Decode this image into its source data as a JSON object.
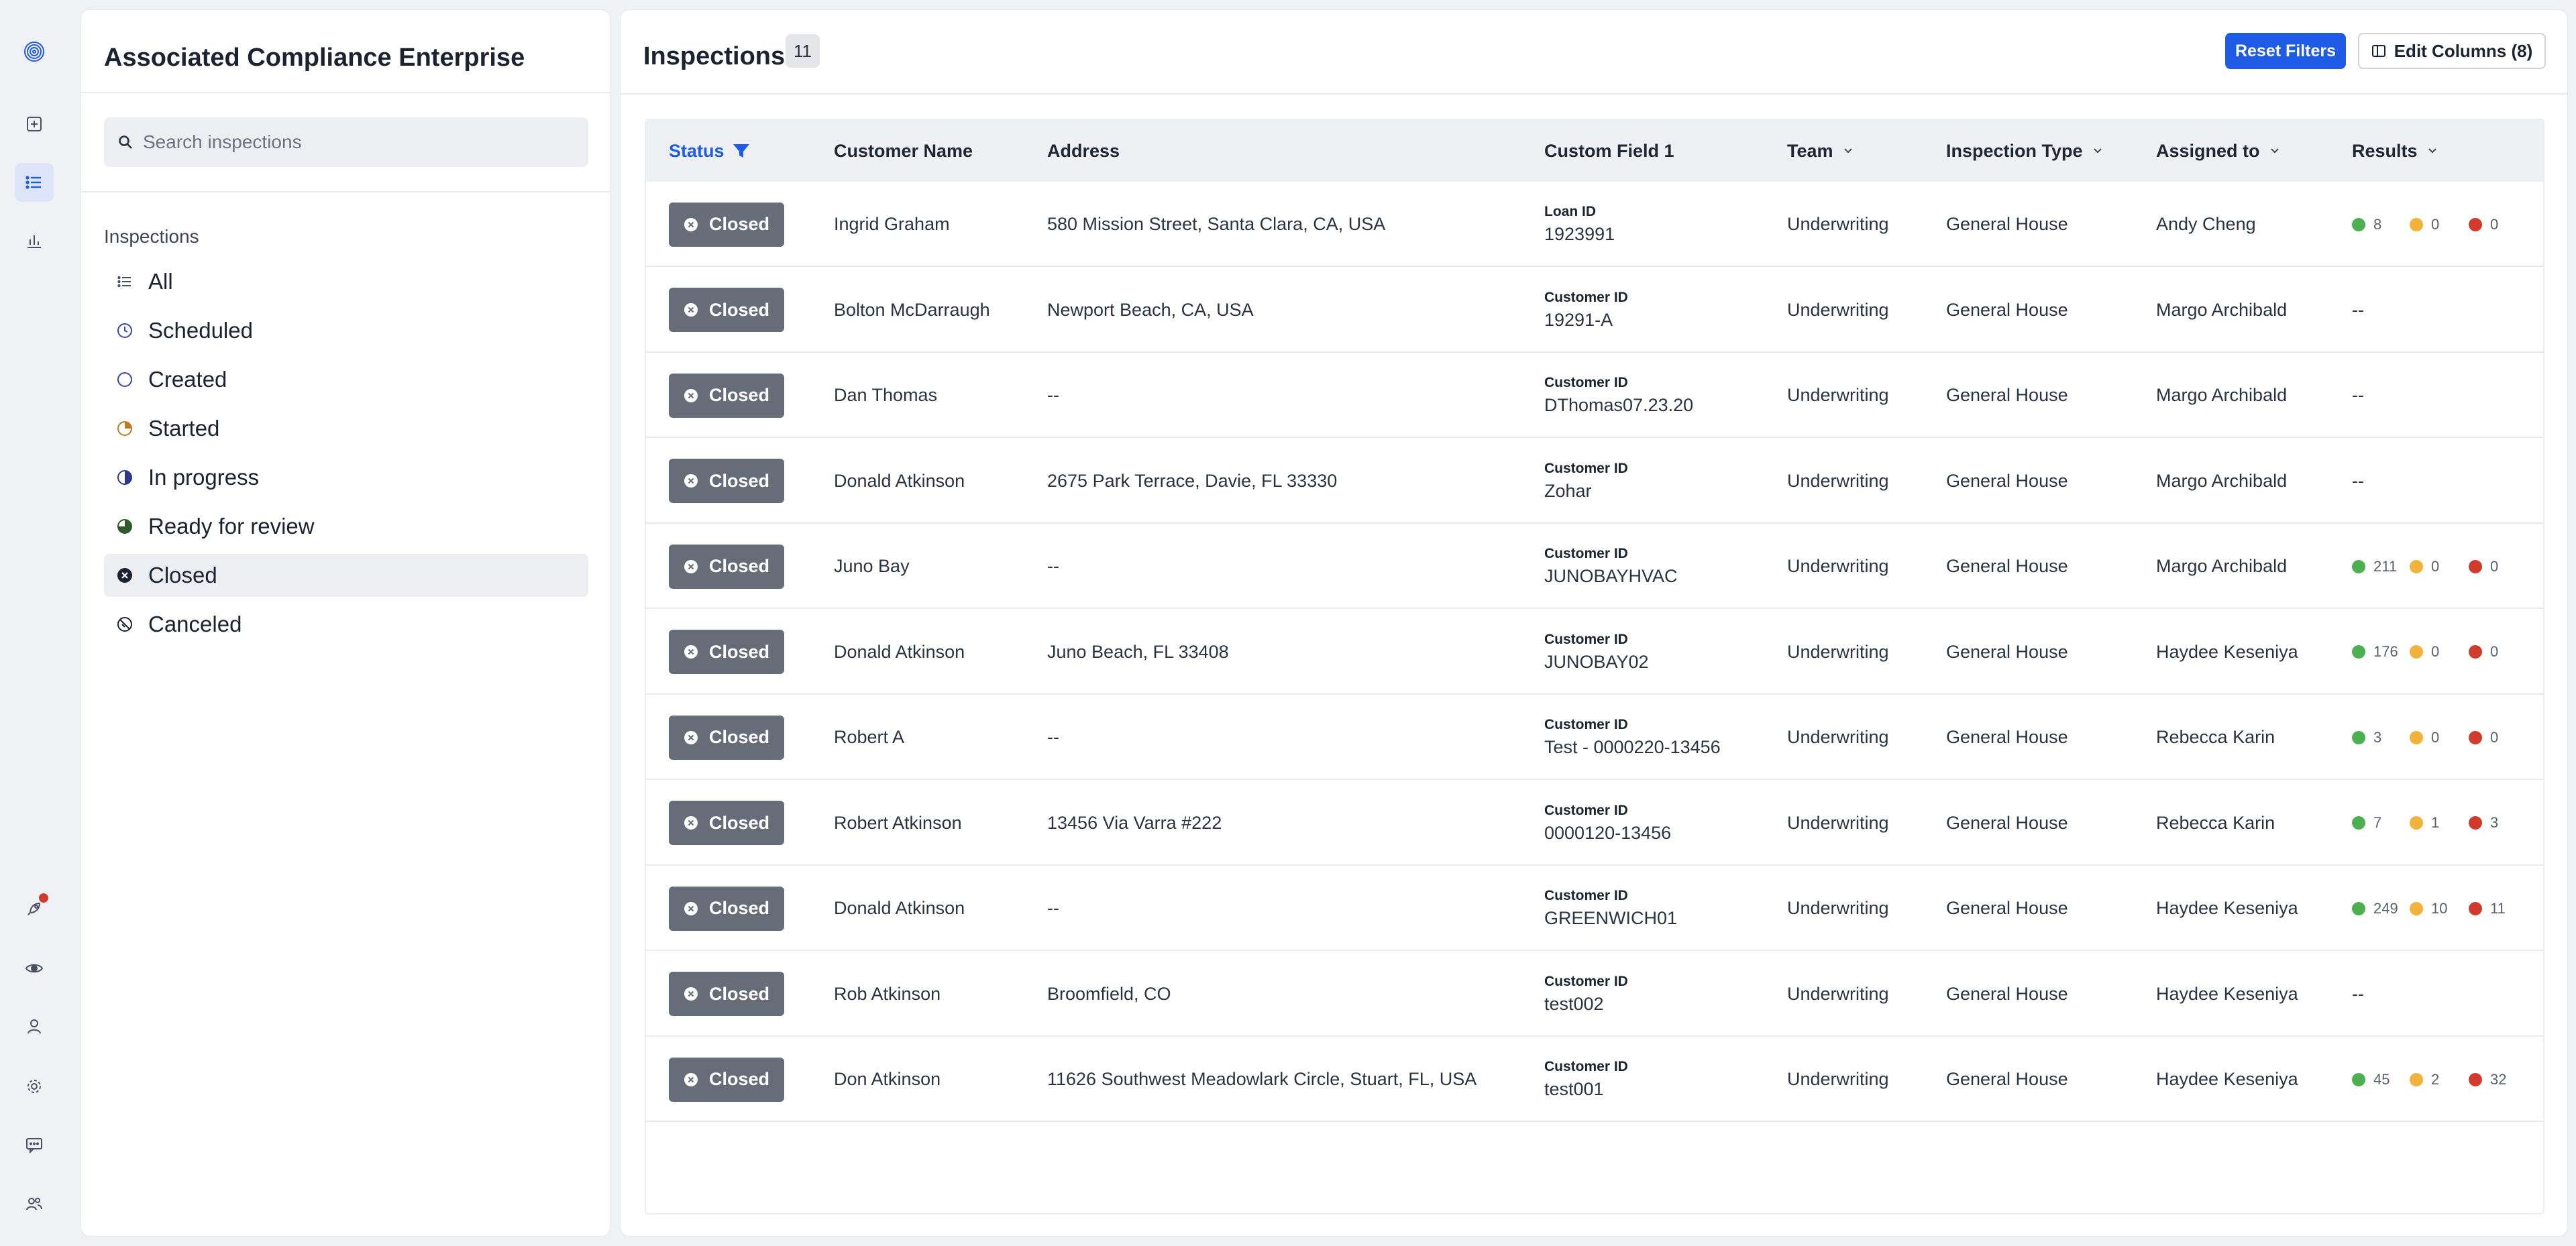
{
  "sidebar": {
    "org_name": "Associated Compliance Enterprise",
    "search_placeholder": "Search inspections",
    "section_label": "Inspections",
    "statuses": [
      {
        "label": "All",
        "icon": "list-icon"
      },
      {
        "label": "Scheduled",
        "icon": "clock-icon"
      },
      {
        "label": "Created",
        "icon": "circle-icon"
      },
      {
        "label": "Started",
        "icon": "quarter-circle-icon"
      },
      {
        "label": "In progress",
        "icon": "half-circle-icon"
      },
      {
        "label": "Ready for review",
        "icon": "three-quarter-circle-icon"
      },
      {
        "label": "Closed",
        "icon": "x-circle-icon",
        "active": true
      },
      {
        "label": "Canceled",
        "icon": "slash-circle-icon"
      }
    ]
  },
  "header": {
    "title": "Inspections",
    "count": "11",
    "reset_filters": "Reset Filters",
    "edit_columns": "Edit Columns (8)"
  },
  "columns": {
    "status": "Status",
    "customer": "Customer Name",
    "address": "Address",
    "custom_field": "Custom Field 1",
    "team": "Team",
    "type": "Inspection Type",
    "assigned": "Assigned to",
    "results": "Results"
  },
  "colors": {
    "accent": "#1e5be6",
    "pass": "#4caf50",
    "warn": "#f0b43c",
    "fail": "#d03b2c",
    "closed_badge": "#676d78"
  },
  "rows": [
    {
      "status": "Closed",
      "customer": "Ingrid Graham",
      "address": "580 Mission Street, Santa Clara, CA, USA",
      "cf_label": "Loan ID",
      "cf_value": "1923991",
      "team": "Underwriting",
      "type": "General House",
      "assigned": "Andy Cheng",
      "results": {
        "green": "8",
        "yellow": "0",
        "red": "0"
      }
    },
    {
      "status": "Closed",
      "customer": "Bolton McDarraugh",
      "address": "Newport Beach, CA, USA",
      "cf_label": "Customer ID",
      "cf_value": "19291-A",
      "team": "Underwriting",
      "type": "General House",
      "assigned": "Margo Archibald",
      "results_text": "--"
    },
    {
      "status": "Closed",
      "customer": "Dan Thomas",
      "address": "--",
      "cf_label": "Customer ID",
      "cf_value": "DThomas07.23.20",
      "team": "Underwriting",
      "type": "General House",
      "assigned": "Margo Archibald",
      "results_text": "--"
    },
    {
      "status": "Closed",
      "customer": "Donald Atkinson",
      "address": "2675 Park Terrace, Davie, FL 33330",
      "cf_label": "Customer ID",
      "cf_value": "Zohar",
      "team": "Underwriting",
      "type": "General House",
      "assigned": "Margo Archibald",
      "results_text": "--"
    },
    {
      "status": "Closed",
      "customer": "Juno Bay",
      "address": "--",
      "cf_label": "Customer ID",
      "cf_value": "JUNOBAYHVAC",
      "team": "Underwriting",
      "type": "General House",
      "assigned": "Margo Archibald",
      "results": {
        "green": "211",
        "yellow": "0",
        "red": "0"
      }
    },
    {
      "status": "Closed",
      "customer": "Donald Atkinson",
      "address": "Juno Beach, FL 33408",
      "cf_label": "Customer ID",
      "cf_value": "JUNOBAY02",
      "team": "Underwriting",
      "type": "General House",
      "assigned": "Haydee Keseniya",
      "results": {
        "green": "176",
        "yellow": "0",
        "red": "0"
      }
    },
    {
      "status": "Closed",
      "customer": "Robert A",
      "address": "--",
      "cf_label": "Customer ID",
      "cf_value": "Test - 0000220-13456",
      "team": "Underwriting",
      "type": "General House",
      "assigned": "Rebecca Karin",
      "results": {
        "green": "3",
        "yellow": "0",
        "red": "0"
      }
    },
    {
      "status": "Closed",
      "customer": "Robert Atkinson",
      "address": "13456 Via Varra #222",
      "cf_label": "Customer ID",
      "cf_value": "0000120-13456",
      "team": "Underwriting",
      "type": "General House",
      "assigned": "Rebecca Karin",
      "results": {
        "green": "7",
        "yellow": "1",
        "red": "3"
      }
    },
    {
      "status": "Closed",
      "customer": "Donald Atkinson",
      "address": "--",
      "cf_label": "Customer ID",
      "cf_value": "GREENWICH01",
      "team": "Underwriting",
      "type": "General House",
      "assigned": "Haydee Keseniya",
      "results": {
        "green": "249",
        "yellow": "10",
        "red": "11"
      }
    },
    {
      "status": "Closed",
      "customer": "Rob Atkinson",
      "address": "Broomfield, CO",
      "cf_label": "Customer ID",
      "cf_value": "test002",
      "team": "Underwriting",
      "type": "General House",
      "assigned": "Haydee Keseniya",
      "results_text": "--"
    },
    {
      "status": "Closed",
      "customer": "Don Atkinson",
      "address": "11626 Southwest Meadowlark Circle, Stuart, FL, USA",
      "cf_label": "Customer ID",
      "cf_value": "test001",
      "team": "Underwriting",
      "type": "General House",
      "assigned": "Haydee Keseniya",
      "results": {
        "green": "45",
        "yellow": "2",
        "red": "32"
      }
    }
  ]
}
